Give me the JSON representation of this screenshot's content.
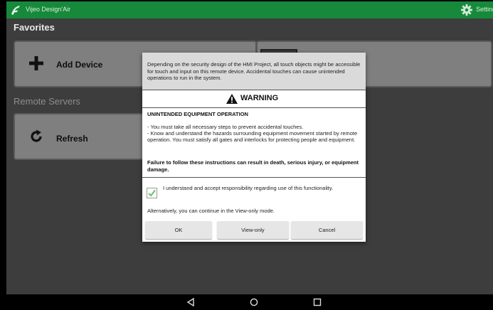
{
  "app": {
    "title": "Vijeo Design'Air",
    "settings_label": "Settings",
    "accent_color": "#168a3a"
  },
  "favorites": {
    "heading": "Favorites",
    "add_device_label": "Add Device"
  },
  "remote_servers": {
    "heading": "Remote Servers",
    "refresh_label": "Refresh"
  },
  "dialog": {
    "intro": "Depending on the security design of the HMI Project, all touch objects might be accessible for touch and input on this remote device. Accidental touches can cause unintended operations to run in the system.",
    "warning_title": "WARNING",
    "hazard_title": "UNINTENDED EQUIPMENT OPERATION",
    "hazard_lines": [
      "- You must take all necessary steps to prevent accidental touches.",
      "- Know and understand the hazards surrounding equipment movement started by remote operation. You must satisfy all gates and interlocks for protecting people and equipment."
    ],
    "hazard_consequence": "Failure to follow these instructions can result in death, serious injury, or equipment damage.",
    "acknowledge_text": "I understand and accept responsibility regarding use of this functionality.",
    "acknowledge_checked": true,
    "alternative_text": "Alternatively, you can continue in the View-only mode.",
    "buttons": {
      "ok": "OK",
      "view_only": "View-only",
      "cancel": "Cancel"
    }
  },
  "icons": {
    "app_logo": "vijeo-logo-icon",
    "settings": "gear-icon",
    "add": "plus-icon",
    "refresh": "refresh-icon",
    "warning": "warning-triangle-icon",
    "nav_back": "back-triangle-icon",
    "nav_home": "home-circle-icon",
    "nav_recents": "recents-square-icon"
  }
}
